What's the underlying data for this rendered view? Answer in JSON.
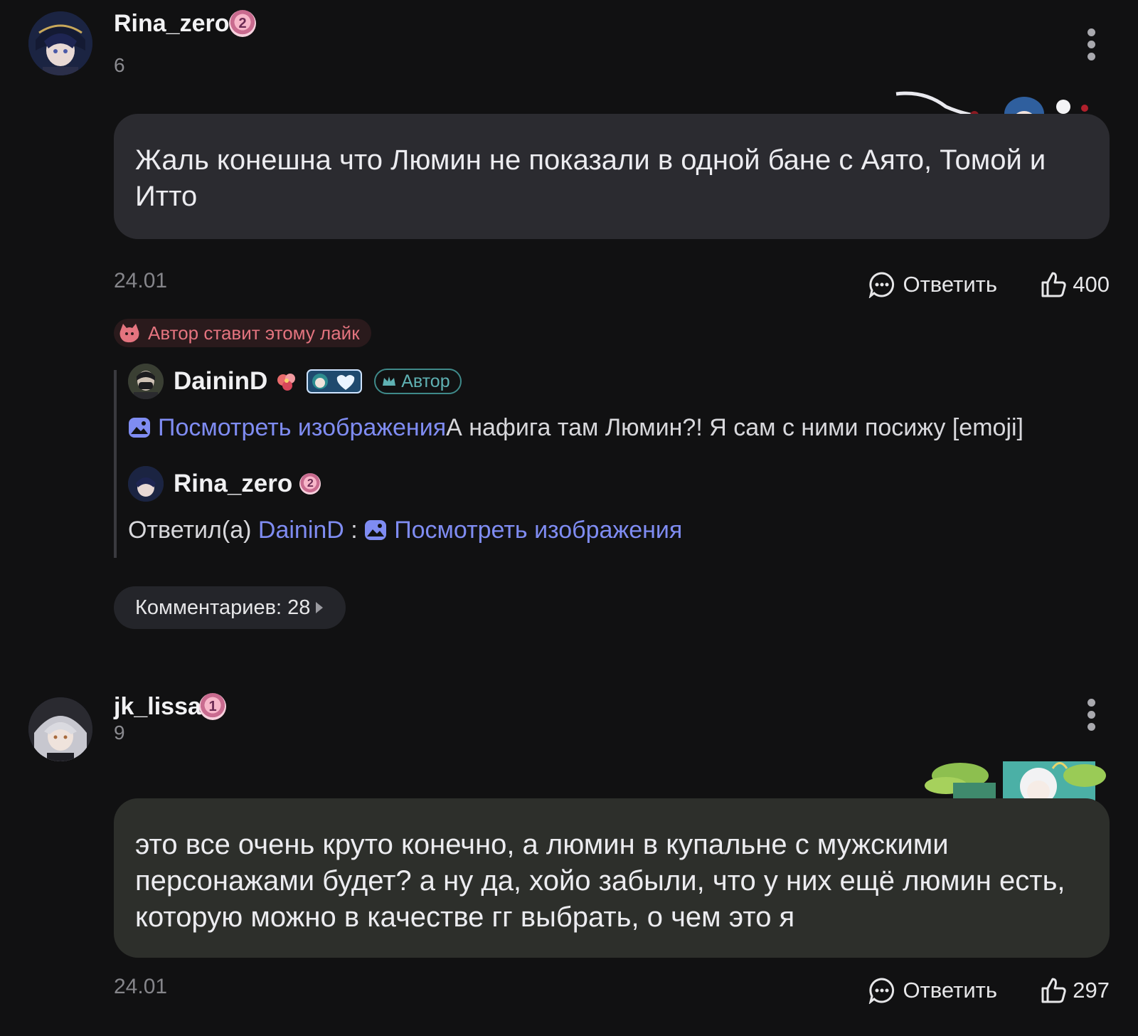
{
  "comments": [
    {
      "username": "Rina_zero",
      "badge_level": "2",
      "level": "6",
      "text": "Жаль конешна что Люмин не показали в одной бане с Аято, Томой и Итто",
      "date": "24.01",
      "reply_label": "Ответить",
      "likes": "400",
      "author_like": "Автор ставит этому лайк",
      "replies": [
        {
          "username": "DaininD",
          "tag": "Автор",
          "link_text": "Посмотреть изображения",
          "text": "А нафига там Люмин?! Я сам с ними посижу [emoji]"
        },
        {
          "username": "Rina_zero",
          "badge_level": "2",
          "prefix": "Ответил(а)",
          "mention": "DaininD",
          "separator": " : ",
          "link_text": "Посмотреть изображения"
        }
      ],
      "comments_count_label": "Комментариев: 28"
    },
    {
      "username": "jk_lissa",
      "badge_level": "1",
      "level": "9",
      "text": "это все очень круто конечно, а люмин в купальне с мужскими персонажами будет? а ну да, хойо забыли, что у них ещё люмин есть, которую можно в качестве гг выбрать, о чем это я",
      "date": "24.01",
      "reply_label": "Ответить",
      "likes": "297"
    }
  ],
  "icons": {
    "more": "more-vertical-icon",
    "reply": "chat-bubble-icon",
    "like": "thumbs-up-icon",
    "image": "image-icon",
    "author_like": "creature-icon"
  },
  "colors": {
    "background": "#111112",
    "bubble": "#2b2b30",
    "link": "#7f8cf2",
    "author_like_text": "#e4747f",
    "author_tag": "#5fb1b3"
  }
}
